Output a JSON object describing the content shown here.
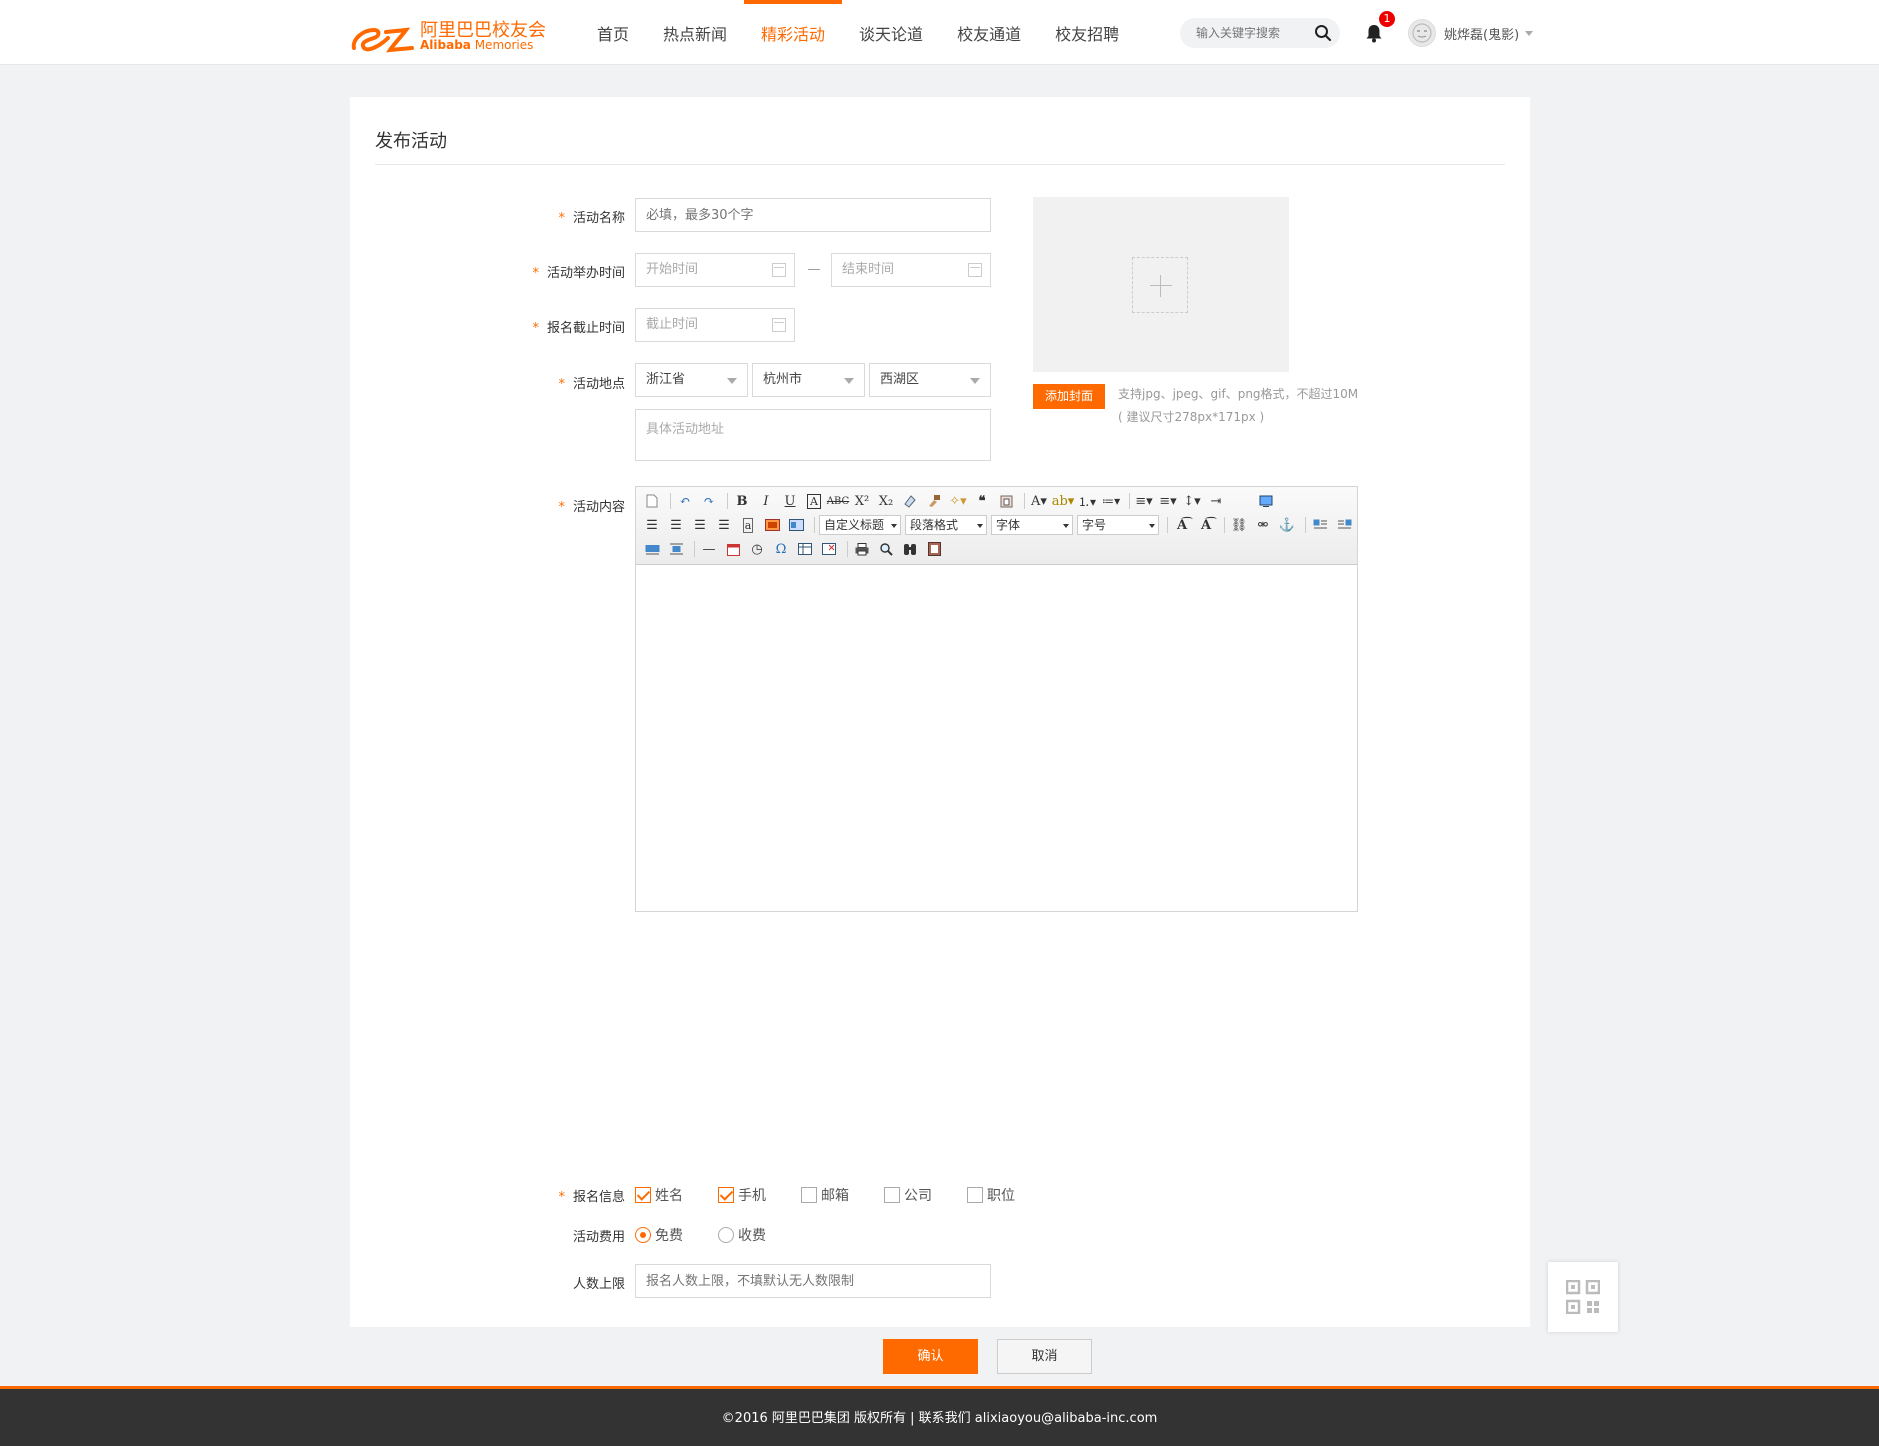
{
  "header": {
    "logo_cn": "阿里巴巴校友会",
    "logo_en_bold": "Alibaba",
    "logo_en_rest": " Memories",
    "nav": [
      "首页",
      "热点新闻",
      "精彩活动",
      "谈天论道",
      "校友通道",
      "校友招聘"
    ],
    "active_nav": "精彩活动",
    "search_placeholder": "输入关键字搜索",
    "notification_count": "1",
    "username": "姚烨磊(鬼影)"
  },
  "form": {
    "title": "发布活动",
    "name_label": "活动名称",
    "name_placeholder": "必填，最多30个字",
    "time_label": "活动举办时间",
    "start_placeholder": "开始时间",
    "dash": "—",
    "end_placeholder": "结束时间",
    "deadline_label": "报名截止时间",
    "deadline_placeholder": "截止时间",
    "location_label": "活动地点",
    "province": "浙江省",
    "city": "杭州市",
    "district": "西湖区",
    "address_placeholder": "具体活动地址",
    "cover_button": "添加封面",
    "cover_hint_1": "支持jpg、jpeg、gif、png格式，不超过10M",
    "cover_hint_2": "( 建议尺寸278px*171px )",
    "content_label": "活动内容",
    "editor": {
      "heading_drop": "自定义标题",
      "paragraph_drop": "段落格式",
      "font_drop": "字体",
      "size_drop": "字号"
    },
    "signup_label": "报名信息",
    "signup_options": [
      {
        "label": "姓名",
        "checked": true
      },
      {
        "label": "手机",
        "checked": true
      },
      {
        "label": "邮箱",
        "checked": false
      },
      {
        "label": "公司",
        "checked": false
      },
      {
        "label": "职位",
        "checked": false
      }
    ],
    "fee_label": "活动费用",
    "fee_free": "免费",
    "fee_paid": "收费",
    "fee_selected": "免费",
    "limit_label": "人数上限",
    "limit_placeholder": "报名人数上限，不填默认无人数限制",
    "confirm_button": "确认",
    "cancel_button": "取消"
  },
  "footer": {
    "text": "©2016 阿里巴巴集团 版权所有 | 联系我们 alixiaoyou@alibaba-inc.com"
  },
  "colors": {
    "accent": "#ff6a00",
    "footer_bg": "#333333",
    "page_bg": "#f1f2f4"
  }
}
